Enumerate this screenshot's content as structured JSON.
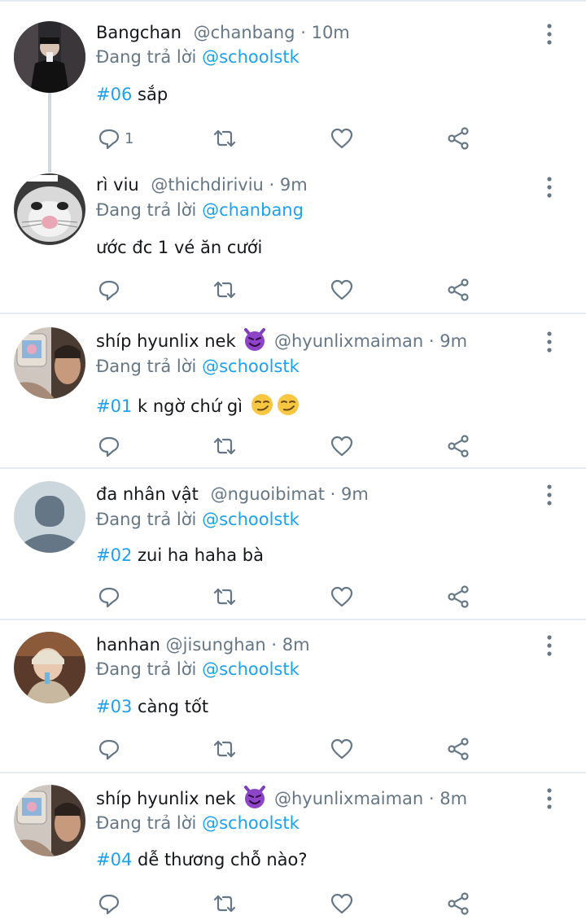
{
  "reply_prefix": "Đang trả lời",
  "dot": "·",
  "tweets": [
    {
      "name": "Bangchan",
      "handle": "@chanbang",
      "time": "10m",
      "reply_to": "@schoolstk",
      "tag": "#06",
      "text": "sắp",
      "reply_count": "1",
      "avatar": "photo-dark-selfie"
    },
    {
      "name": "rì viu",
      "handle": "@thichdiriviu",
      "time": "9m",
      "reply_to": "@chanbang",
      "tag": "",
      "text": "ước đc 1 vé ăn cưới",
      "reply_count": "",
      "avatar": "photo-cat-face"
    },
    {
      "name": "shíp hyunlix nek",
      "handle": "@hyunlixmaiman",
      "time": "9m",
      "reply_to": "@schoolstk",
      "tag": "#01",
      "text": "k ngờ chứ gì",
      "reply_count": "",
      "avatar": "photo-collage",
      "name_emoji": "smiling-imp-emoji",
      "text_emoji": "smirking-face-emoji"
    },
    {
      "name": "đa nhân vật",
      "handle": "@nguoibimat",
      "time": "9m",
      "reply_to": "@schoolstk",
      "tag": "#02",
      "text": "zui ha haha bà",
      "reply_count": "",
      "avatar": "default-avatar"
    },
    {
      "name": "hanhan",
      "handle": "@jisunghan",
      "time": "8m",
      "reply_to": "@schoolstk",
      "tag": "#03",
      "text": "càng tốt",
      "reply_count": "",
      "avatar": "photo-person"
    },
    {
      "name": "shíp hyunlix nek",
      "handle": "@hyunlixmaiman",
      "time": "8m",
      "reply_to": "@schoolstk",
      "tag": "#04",
      "text": "dễ thương chỗ nào?",
      "reply_count": "",
      "avatar": "photo-collage",
      "name_emoji": "smiling-imp-emoji"
    }
  ]
}
